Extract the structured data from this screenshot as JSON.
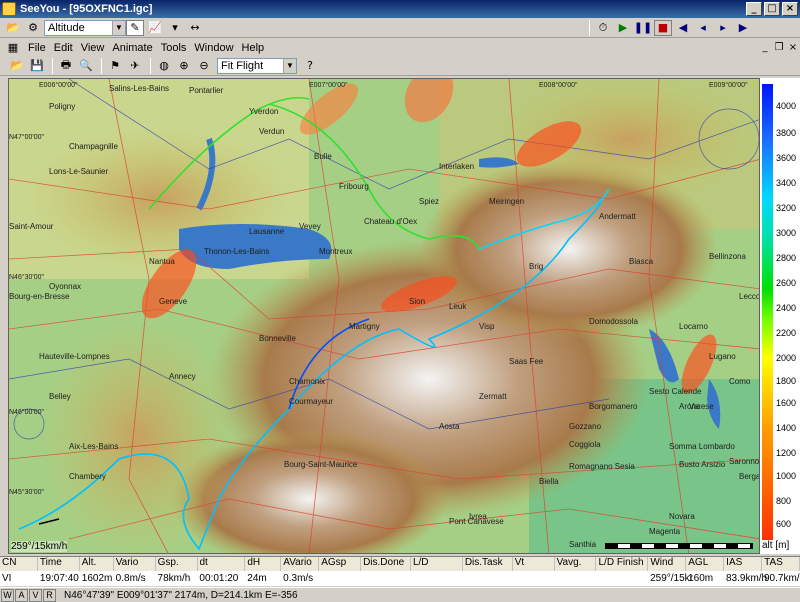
{
  "window": {
    "app": "SeeYou",
    "title": "SeeYou - [95OXFNC1.igc]"
  },
  "toolbar1": {
    "altitude_select": "Altitude"
  },
  "menu": [
    "File",
    "Edit",
    "View",
    "Animate",
    "Tools",
    "Window",
    "Help"
  ],
  "toolbar2": {
    "zoom_select": "Fit Flight"
  },
  "map": {
    "labels": [
      "Salins-Les-Bains",
      "Poligny",
      "Champagnille",
      "Lons-Le-Saunier",
      "Saint-Amour",
      "Oyonnax",
      "Bourg-en-Bresse",
      "Nantua",
      "Hauteville-Lompnes",
      "Belley",
      "Aix-Les-Bains",
      "Chambery",
      "Annecy",
      "Bonneville",
      "Thonon-Les-Bains",
      "Geneve",
      "Vevey",
      "Montreux",
      "Martigny",
      "Sion",
      "Brig",
      "Domodossola",
      "Locarno",
      "Lugano",
      "Varese",
      "Como",
      "Lecco",
      "Bergamo",
      "Biella",
      "Aosta",
      "Ivrea",
      "Courmayeur",
      "Chamonix",
      "Bourg-Saint-Maurice",
      "Pont Canavese",
      "Santhia",
      "Novara",
      "Magenta",
      "Sesto Calende",
      "Borgomanero",
      "Gozzano",
      "Coggiola",
      "Romagnano Sesia",
      "Arona",
      "Saronno",
      "Somma Lombardo",
      "Busto Arsizio",
      "Verdun",
      "Fribourg",
      "Bulle",
      "Chateau d'Oex",
      "Spiez",
      "Interlaken",
      "Meiringen",
      "Andermatt",
      "Biasca",
      "Bellinzona",
      "Pontarlier",
      "Yverdon",
      "Lausanne",
      "Zermatt",
      "Saas Fee",
      "Visp",
      "Leuk"
    ],
    "wind_text": "259°/15km/h",
    "coordinate_marks": [
      "E006°00'00\"",
      "E007°00'00\"",
      "E008°00'00\"",
      "E009°00'00\"",
      "N47°00'00\"",
      "N46°30'00\"",
      "N46°00'00\"",
      "N45°30'00\""
    ]
  },
  "altitude_scale": {
    "labels": [
      "4000",
      "3800",
      "3600",
      "3400",
      "3200",
      "3000",
      "2800",
      "2600",
      "2400",
      "2200",
      "2000",
      "1800",
      "1600",
      "1400",
      "1200",
      "1000",
      "800",
      "600"
    ],
    "unit": "alt [m]"
  },
  "flight_table": {
    "headers": [
      "CN",
      "Time",
      "Alt.",
      "Vario",
      "Gsp.",
      "dt",
      "dH",
      "AVario",
      "AGsp",
      "Dis.Done",
      "L/D",
      "Dis.Task",
      "Vt",
      "Vavg.",
      "L/D Finish",
      "Wind",
      "AGL",
      "IAS",
      "TAS"
    ],
    "row": [
      "VI",
      "19:07:40",
      "1602m",
      "0.8m/s",
      "78km/h",
      "00:01:20",
      "24m",
      "0.3m/s",
      "",
      "",
      "",
      "",
      "",
      "",
      "",
      "259°/15kr",
      "160m",
      "83.9km/h",
      "90.7km/h"
    ]
  },
  "statusbar": {
    "tabs": [
      "W",
      "A",
      "V",
      "R"
    ],
    "coords": "N46°47'39\"  E009°01'37\" 2174m, D=214.1km E=-356"
  },
  "colors": {
    "titlebar": "#0a246a",
    "flight_low": "#00d000",
    "flight_mid": "#00c8ff",
    "flight_high": "#0040ff",
    "airspace": "#ff6020"
  }
}
